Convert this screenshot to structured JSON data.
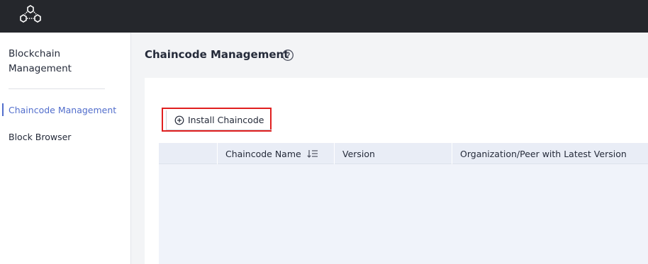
{
  "topbar": {
    "logo_icon": "hexagon-network-logo-icon"
  },
  "sidebar": {
    "title": "Blockchain Management",
    "items": [
      {
        "label": "Chaincode Management",
        "active": true
      },
      {
        "label": "Block Browser",
        "active": false
      }
    ]
  },
  "main": {
    "title": "Chaincode Management",
    "help_icon": "question-circle-icon",
    "install_button": {
      "label": "Install Chaincode",
      "icon": "plus-circle-icon"
    },
    "table": {
      "columns": [
        {
          "label": ""
        },
        {
          "label": "Chaincode Name",
          "sort_icon": "sort-descending-icon"
        },
        {
          "label": "Version"
        },
        {
          "label": "Organization/Peer with Latest Version"
        }
      ],
      "rows": []
    }
  },
  "colors": {
    "topbar": "#25272c",
    "accent": "#526ecc",
    "highlight_border": "#e01f1f",
    "table_bg": "#f0f3fa"
  }
}
